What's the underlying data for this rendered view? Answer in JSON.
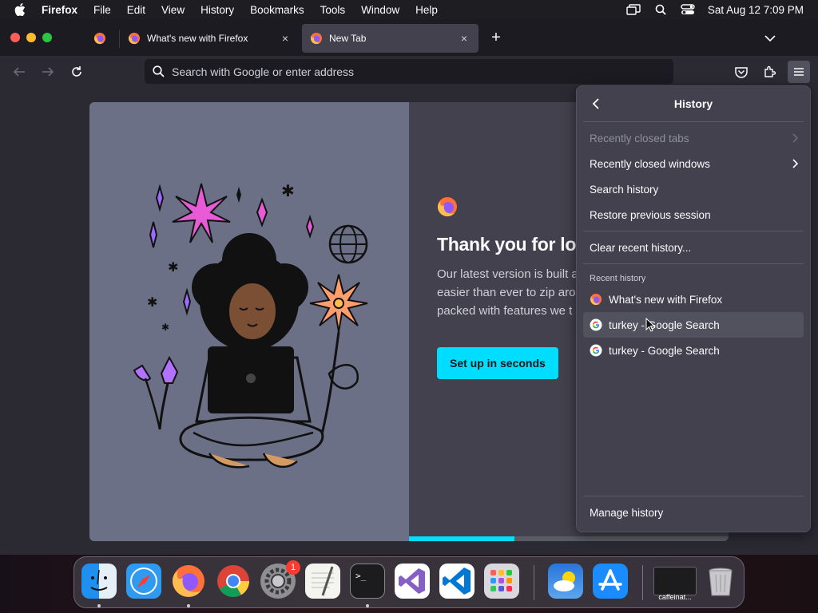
{
  "menubar": {
    "app_name": "Firefox",
    "items": [
      "File",
      "Edit",
      "View",
      "History",
      "Bookmarks",
      "Tools",
      "Window",
      "Help"
    ],
    "datetime": "Sat Aug 12  7:09 PM"
  },
  "tabs": [
    {
      "title": ""
    },
    {
      "title": "What's new with Firefox",
      "close": "×"
    },
    {
      "title": "New Tab",
      "close": "×",
      "active": true
    }
  ],
  "newtab_label": "+",
  "urlbar": {
    "placeholder": "Search with Google or enter address"
  },
  "newtab_page": {
    "heading": "Thank you for lov",
    "body": "Our latest version is built a\neasier than ever to zip aro\npacked with features we t",
    "cta": "Set up in seconds",
    "progress_fraction": 0.33
  },
  "history_panel": {
    "title": "History",
    "items": [
      {
        "label": "Recently closed tabs",
        "disabled": true,
        "submenu": true
      },
      {
        "label": "Recently closed windows",
        "disabled": false,
        "submenu": true
      },
      {
        "label": "Search history"
      },
      {
        "label": "Restore previous session"
      }
    ],
    "clear": "Clear recent history...",
    "recent_label": "Recent history",
    "recent": [
      {
        "label": "What's new with Firefox",
        "icon": "firefox-icon"
      },
      {
        "label": "turkey - Google Search",
        "icon": "google-icon",
        "hover": true
      },
      {
        "label": "turkey - Google Search",
        "icon": "google-icon"
      }
    ],
    "manage": "Manage history"
  },
  "dock": {
    "settings_badge": "1",
    "caffeinate_caption": "caffeinat..."
  },
  "colors": {
    "accent": "#00ddff",
    "toolbar": "#2b2a33",
    "panel": "#42414d"
  }
}
